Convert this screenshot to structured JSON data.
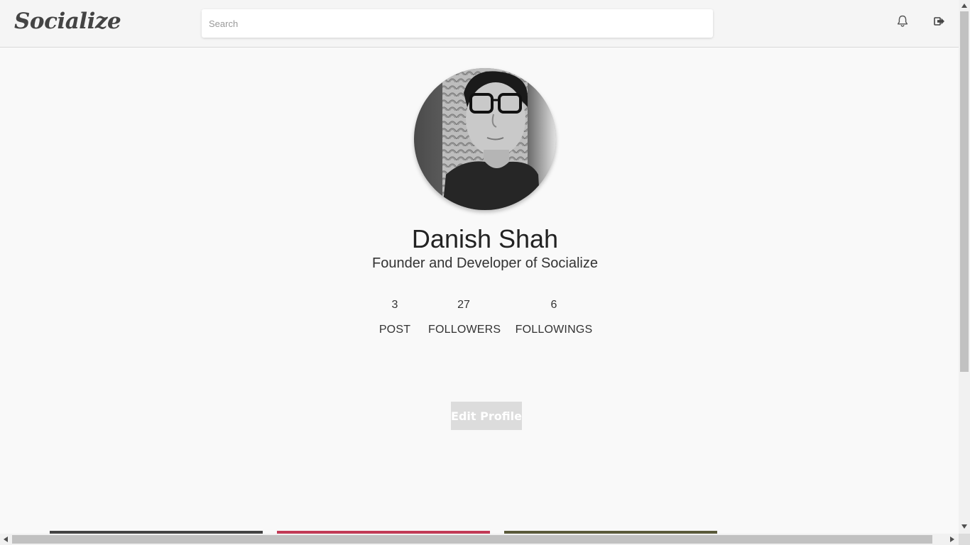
{
  "app": {
    "logo_text": "Socialize"
  },
  "header": {
    "search": {
      "placeholder": "Search",
      "value": ""
    },
    "icons": [
      "bell-icon",
      "logout-icon"
    ]
  },
  "profile": {
    "name": "Danish Shah",
    "bio": "Founder and Developer of Socialize",
    "stats": {
      "posts": {
        "value": "3",
        "label": "POST"
      },
      "followers": {
        "value": "27",
        "label": "FOLLOWERS"
      },
      "followings": {
        "value": "6",
        "label": "FOLLOWINGS"
      }
    },
    "edit_button_label": "Edit Profile"
  },
  "colors": {
    "background": "#f9f9f9",
    "navbar": "#f5f5f5",
    "button_disabled": "#dcdcdc"
  }
}
